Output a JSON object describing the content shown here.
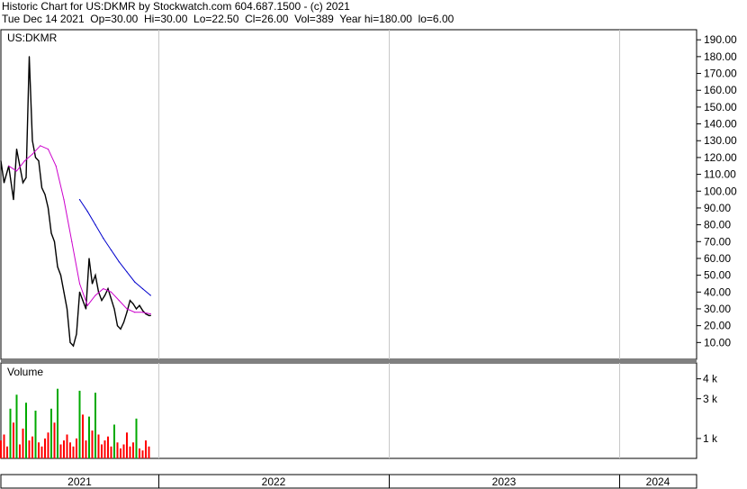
{
  "header": {
    "line1": "Historic Chart for US:DKMR by Stockwatch.com 604.687.1500 - (c) 2021",
    "line2": "Tue Dec 14 2021  Op=30.00  Hi=30.00  Lo=22.50  Cl=26.00  Vol=389  Year hi=180.00  lo=6.00"
  },
  "chart_data": [
    {
      "type": "line",
      "title": "US:DKMR",
      "ylim": [
        0,
        196
      ],
      "yticks": [
        "190.00",
        "180.00",
        "170.00",
        "160.00",
        "150.00",
        "140.00",
        "130.00",
        "120.00",
        "110.00",
        "100.00",
        "90.00",
        "80.00",
        "70.00",
        "60.00",
        "50.00",
        "40.00",
        "30.00",
        "20.00",
        "10.00"
      ],
      "x_labels": [
        "2021",
        "2022",
        "2023",
        "2024"
      ],
      "series": [
        {
          "color": "#000000",
          "x": [
            2021.0,
            2021.02,
            2021.05,
            2021.08,
            2021.1,
            2021.12,
            2021.14,
            2021.16,
            2021.18,
            2021.2,
            2021.22,
            2021.24,
            2021.26,
            2021.28,
            2021.3,
            2021.32,
            2021.34,
            2021.36,
            2021.38,
            2021.4,
            2021.42,
            2021.44,
            2021.46,
            2021.48,
            2021.5,
            2021.52,
            2021.54,
            2021.56,
            2021.58,
            2021.6,
            2021.62,
            2021.64,
            2021.66,
            2021.68,
            2021.7,
            2021.72,
            2021.74,
            2021.76,
            2021.78,
            2021.8,
            2021.82,
            2021.84,
            2021.86,
            2021.88,
            2021.9,
            2021.92,
            2021.94,
            2021.95
          ],
          "values": [
            118,
            105,
            115,
            95,
            125,
            115,
            105,
            108,
            180,
            130,
            120,
            118,
            102,
            98,
            90,
            75,
            70,
            55,
            50,
            40,
            30,
            10,
            8,
            15,
            40,
            35,
            30,
            60,
            45,
            50,
            40,
            35,
            38,
            42,
            36,
            30,
            20,
            18,
            22,
            28,
            35,
            33,
            30,
            32,
            29,
            27,
            26,
            26
          ]
        },
        {
          "color": "#cc00cc",
          "x": [
            2021.05,
            2021.1,
            2021.15,
            2021.2,
            2021.25,
            2021.3,
            2021.35,
            2021.4,
            2021.45,
            2021.5,
            2021.55,
            2021.6,
            2021.65,
            2021.7,
            2021.75,
            2021.8,
            2021.85,
            2021.9,
            2021.95
          ],
          "values": [
            115,
            112,
            118,
            122,
            127,
            125,
            115,
            95,
            70,
            45,
            32,
            38,
            42,
            40,
            35,
            30,
            28,
            28,
            27
          ]
        },
        {
          "color": "#0000cc",
          "x": [
            2021.5,
            2021.55,
            2021.6,
            2021.65,
            2021.7,
            2021.75,
            2021.8,
            2021.85,
            2021.9,
            2021.95
          ],
          "values": [
            95,
            88,
            80,
            72,
            65,
            58,
            52,
            46,
            42,
            38
          ]
        }
      ]
    },
    {
      "type": "bar",
      "title": "Volume",
      "ylim": [
        0,
        4800
      ],
      "yticks": [
        "4 k",
        "3 k",
        "1 k"
      ],
      "ytick_values": [
        4000,
        3000,
        1000
      ],
      "x": [
        2021.0,
        2021.02,
        2021.04,
        2021.06,
        2021.08,
        2021.1,
        2021.12,
        2021.14,
        2021.16,
        2021.18,
        2021.2,
        2021.22,
        2021.24,
        2021.26,
        2021.28,
        2021.3,
        2021.32,
        2021.34,
        2021.36,
        2021.38,
        2021.4,
        2021.42,
        2021.44,
        2021.46,
        2021.48,
        2021.5,
        2021.52,
        2021.54,
        2021.56,
        2021.58,
        2021.6,
        2021.62,
        2021.64,
        2021.66,
        2021.68,
        2021.7,
        2021.72,
        2021.74,
        2021.76,
        2021.78,
        2021.8,
        2021.82,
        2021.84,
        2021.86,
        2021.88,
        2021.9,
        2021.92,
        2021.94
      ],
      "values": [
        900,
        1200,
        600,
        2500,
        1800,
        3200,
        700,
        1500,
        2800,
        900,
        1100,
        2400,
        800,
        600,
        1000,
        1300,
        2500,
        1800,
        3500,
        700,
        900,
        1200,
        800,
        600,
        1000,
        3400,
        2200,
        900,
        2100,
        1400,
        3300,
        1200,
        700,
        900,
        1100,
        600,
        1700,
        800,
        500,
        700,
        1300,
        600,
        800,
        2000,
        500,
        400,
        900,
        600
      ],
      "colors": [
        "#ff0000",
        "#ff0000",
        "#ff0000",
        "#00aa00",
        "#ff0000",
        "#00aa00",
        "#ff0000",
        "#ff0000",
        "#00aa00",
        "#ff0000",
        "#ff0000",
        "#00aa00",
        "#ff0000",
        "#ff0000",
        "#ff0000",
        "#ff0000",
        "#00aa00",
        "#ff0000",
        "#00aa00",
        "#ff0000",
        "#ff0000",
        "#ff0000",
        "#ff0000",
        "#ff0000",
        "#ff0000",
        "#00aa00",
        "#ff0000",
        "#ff0000",
        "#00aa00",
        "#ff0000",
        "#00aa00",
        "#ff0000",
        "#ff0000",
        "#ff0000",
        "#ff0000",
        "#ff0000",
        "#00aa00",
        "#ff0000",
        "#ff0000",
        "#ff0000",
        "#ff0000",
        "#ff0000",
        "#ff0000",
        "#00aa00",
        "#ff0000",
        "#ff0000",
        "#ff0000",
        "#ff0000"
      ]
    }
  ]
}
